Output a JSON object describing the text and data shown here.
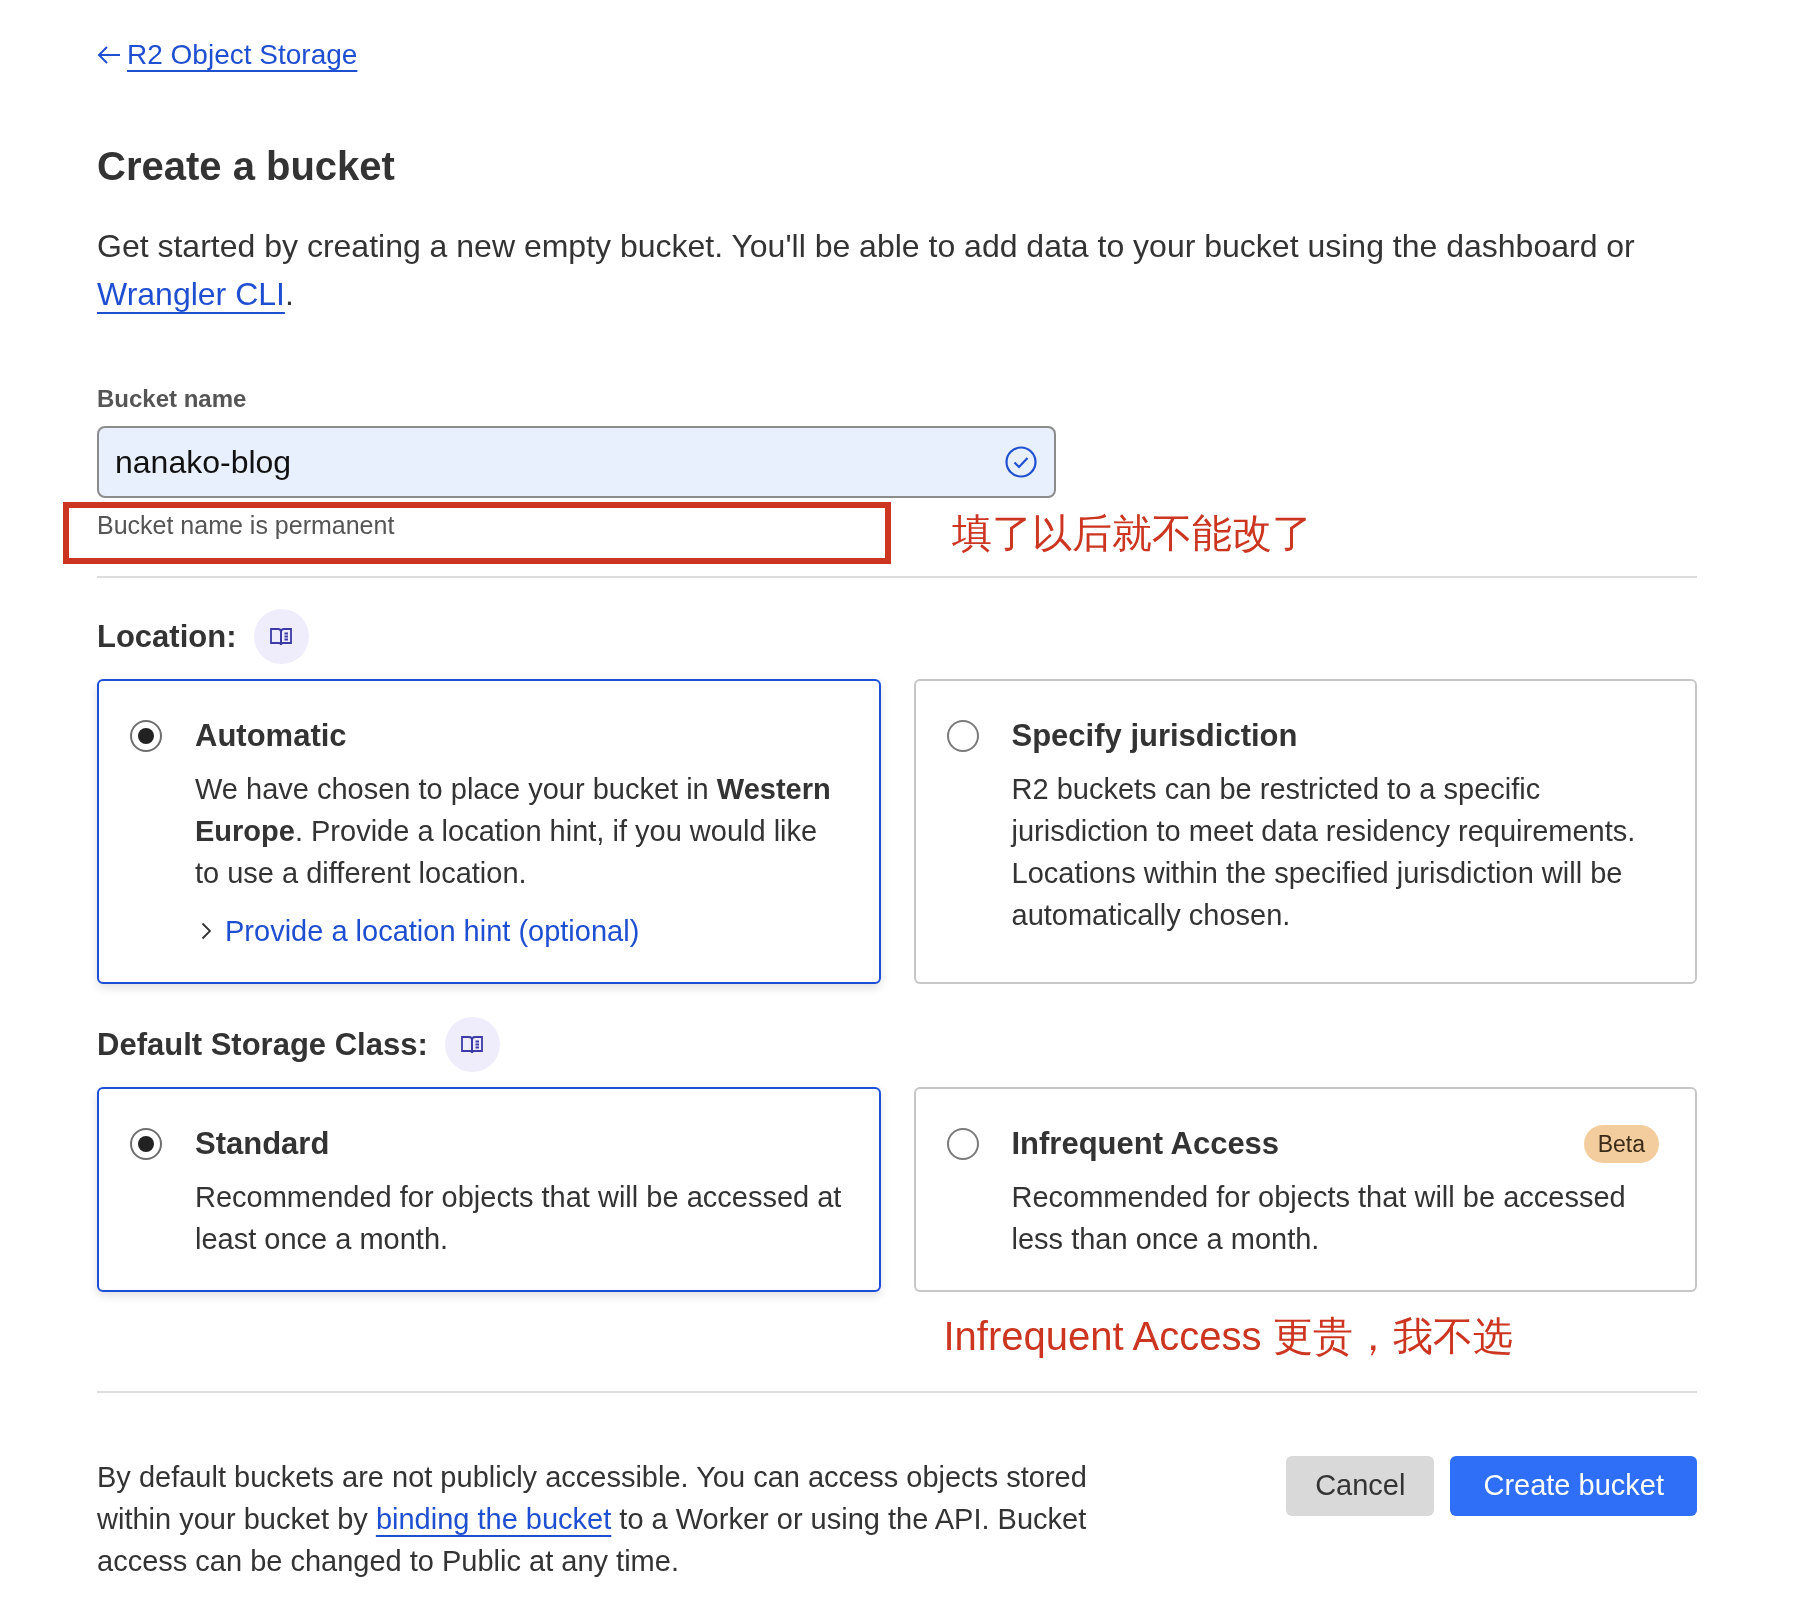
{
  "back_link": {
    "label": "R2 Object Storage"
  },
  "page_title": "Create a bucket",
  "intro": {
    "text": "Get started by creating a new empty bucket. You'll be able to add data to your bucket using the dashboard or",
    "link": "Wrangler CLI",
    "after": "."
  },
  "bucket_name": {
    "label": "Bucket name",
    "value": "nanako-blog",
    "valid": true,
    "helper": "Bucket name is permanent",
    "helper_highlighted": true,
    "annotation": "填了以后就不能改了"
  },
  "location": {
    "label": "Location:",
    "options": [
      {
        "title": "Automatic",
        "selected": true,
        "description": "We have chosen to place your bucket in **Western Europe**. Provide a location hint, if you would like to use a different location.",
        "link": "Provide a location hint (optional)"
      },
      {
        "title": "Specify jurisdiction",
        "selected": false,
        "description": "R2 buckets can be restricted to a specific jurisdiction to meet data residency requirements. Locations within the specified jurisdiction will be automatically chosen."
      }
    ]
  },
  "storage_class": {
    "label": "Default Storage Class:",
    "options": [
      {
        "title": "Standard",
        "selected": true,
        "description": "Recommended for objects that will be accessed at least once a month."
      },
      {
        "title": "Infrequent Access",
        "selected": false,
        "badge": "Beta",
        "description": "Recommended for objects that will be accessed less than once a month."
      }
    ],
    "annotation": "Infrequent Access 更贵，我不选"
  },
  "footer": {
    "text_before": "By default buckets are not publicly accessible. You can access objects stored within your bucket by",
    "link": "binding the bucket",
    "text_after": "to a Worker or using the API. Bucket access can be changed to Public at any time."
  },
  "buttons": [
    {
      "label": "Cancel",
      "kind": "secondary"
    },
    {
      "label": "Create bucket",
      "kind": "primary"
    }
  ]
}
